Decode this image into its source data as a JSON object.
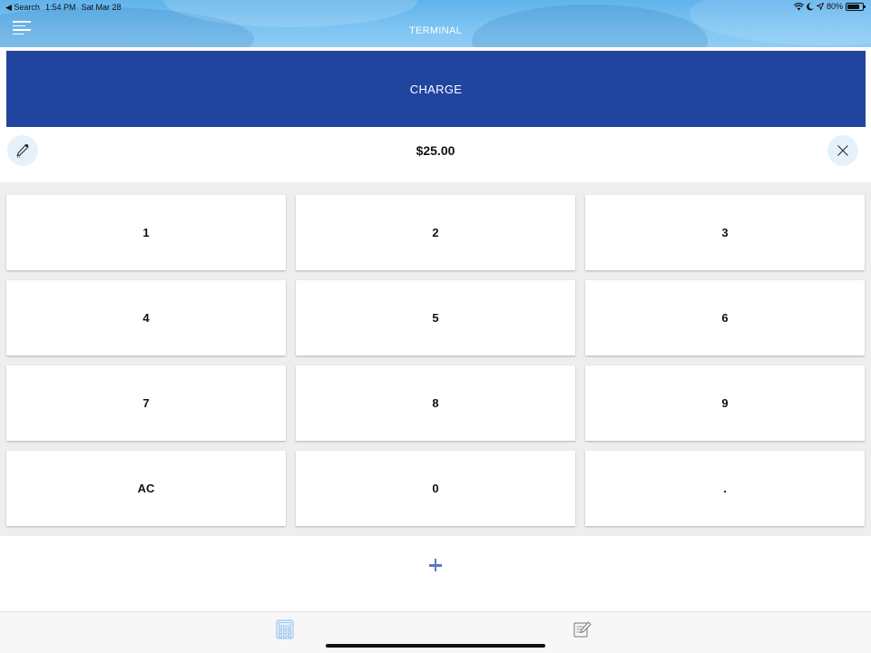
{
  "status_bar": {
    "back_label": "◀ Search",
    "time": "1:54 PM",
    "date": "Sat Mar 28",
    "battery_text": "80%",
    "battery_level": 0.8
  },
  "nav": {
    "title": "TERMINAL",
    "menu_icon": "hamburger-menu-icon"
  },
  "charge": {
    "label": "CHARGE",
    "color": "#21449e"
  },
  "amount": {
    "value": "$25.00",
    "edit_icon": "pen-icon",
    "clear_icon": "close-icon"
  },
  "keypad": {
    "keys": [
      "1",
      "2",
      "3",
      "4",
      "5",
      "6",
      "7",
      "8",
      "9",
      "AC",
      "0",
      "."
    ]
  },
  "add_item": {
    "icon": "plus-icon",
    "color": "#5d77c4"
  },
  "tab_bar": {
    "tabs": [
      {
        "icon": "calculator-icon",
        "active": true
      },
      {
        "icon": "notes-edit-icon",
        "active": false
      }
    ]
  },
  "colors": {
    "header": "#7ec4f2",
    "accent": "#21449e",
    "keypad_bg": "#eeeeee"
  }
}
